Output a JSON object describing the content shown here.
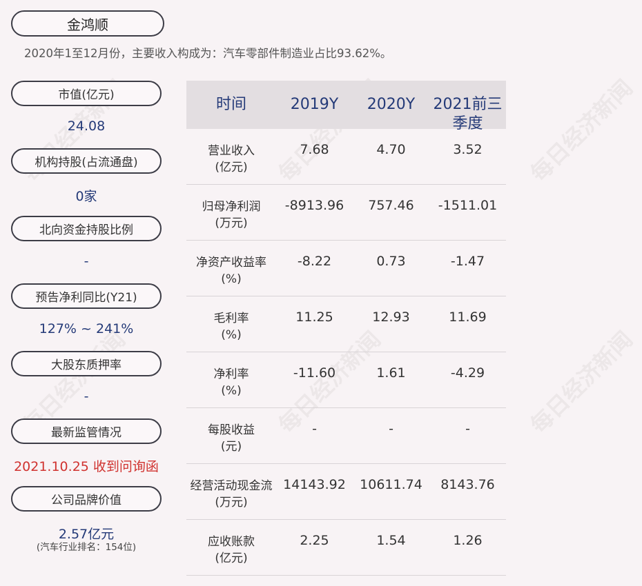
{
  "company": "金鸿顺",
  "subtitle": "2020年1至12月份，主要收入构成为：汽车零部件制造业占比93.62%。",
  "watermark": "每日经济新闻",
  "side": [
    {
      "label": "市值(亿元)",
      "value": "24.08"
    },
    {
      "label": "机构持股(占流通盘)",
      "value": "0家"
    },
    {
      "label": "北向资金持股比例",
      "value": "-"
    },
    {
      "label": "预告净利同比(Y21)",
      "value": "127% ~ 241%"
    },
    {
      "label": "大股东质押率",
      "value": "-"
    },
    {
      "label": "最新监管情况",
      "value": "2021.10.25 收到问询函"
    },
    {
      "label": "公司品牌价值",
      "value": "2.57亿元",
      "note": "(汽车行业排名：154位)"
    }
  ],
  "table": {
    "headers": {
      "time": "时间",
      "y2019": "2019Y",
      "y2020": "2020Y",
      "y2021_a": "2021前三",
      "y2021_b": "季度"
    },
    "rows": [
      {
        "label_a": "营业收入",
        "label_b": "(亿元)",
        "v2019": "7.68",
        "v2020": "4.70",
        "v2021": "3.52"
      },
      {
        "label_a": "归母净利润",
        "label_b": "(万元)",
        "v2019": "-8913.96",
        "v2020": "757.46",
        "v2021": "-1511.01"
      },
      {
        "label_a": "净资产收益率",
        "label_b": "(%)",
        "v2019": "-8.22",
        "v2020": "0.73",
        "v2021": "-1.47"
      },
      {
        "label_a": "毛利率",
        "label_b": "(%)",
        "v2019": "11.25",
        "v2020": "12.93",
        "v2021": "11.69"
      },
      {
        "label_a": "净利率",
        "label_b": "(%)",
        "v2019": "-11.60",
        "v2020": "1.61",
        "v2021": "-4.29"
      },
      {
        "label_a": "每股收益",
        "label_b": "(元)",
        "v2019": "-",
        "v2020": "-",
        "v2021": "-"
      },
      {
        "label_a": "经营活动现金流",
        "label_b": "(万元)",
        "v2019": "14143.92",
        "v2020": "10611.74",
        "v2021": "8143.76"
      },
      {
        "label_a": "应收账款",
        "label_b": "(亿元)",
        "v2019": "2.25",
        "v2020": "1.54",
        "v2021": "1.26"
      }
    ]
  }
}
